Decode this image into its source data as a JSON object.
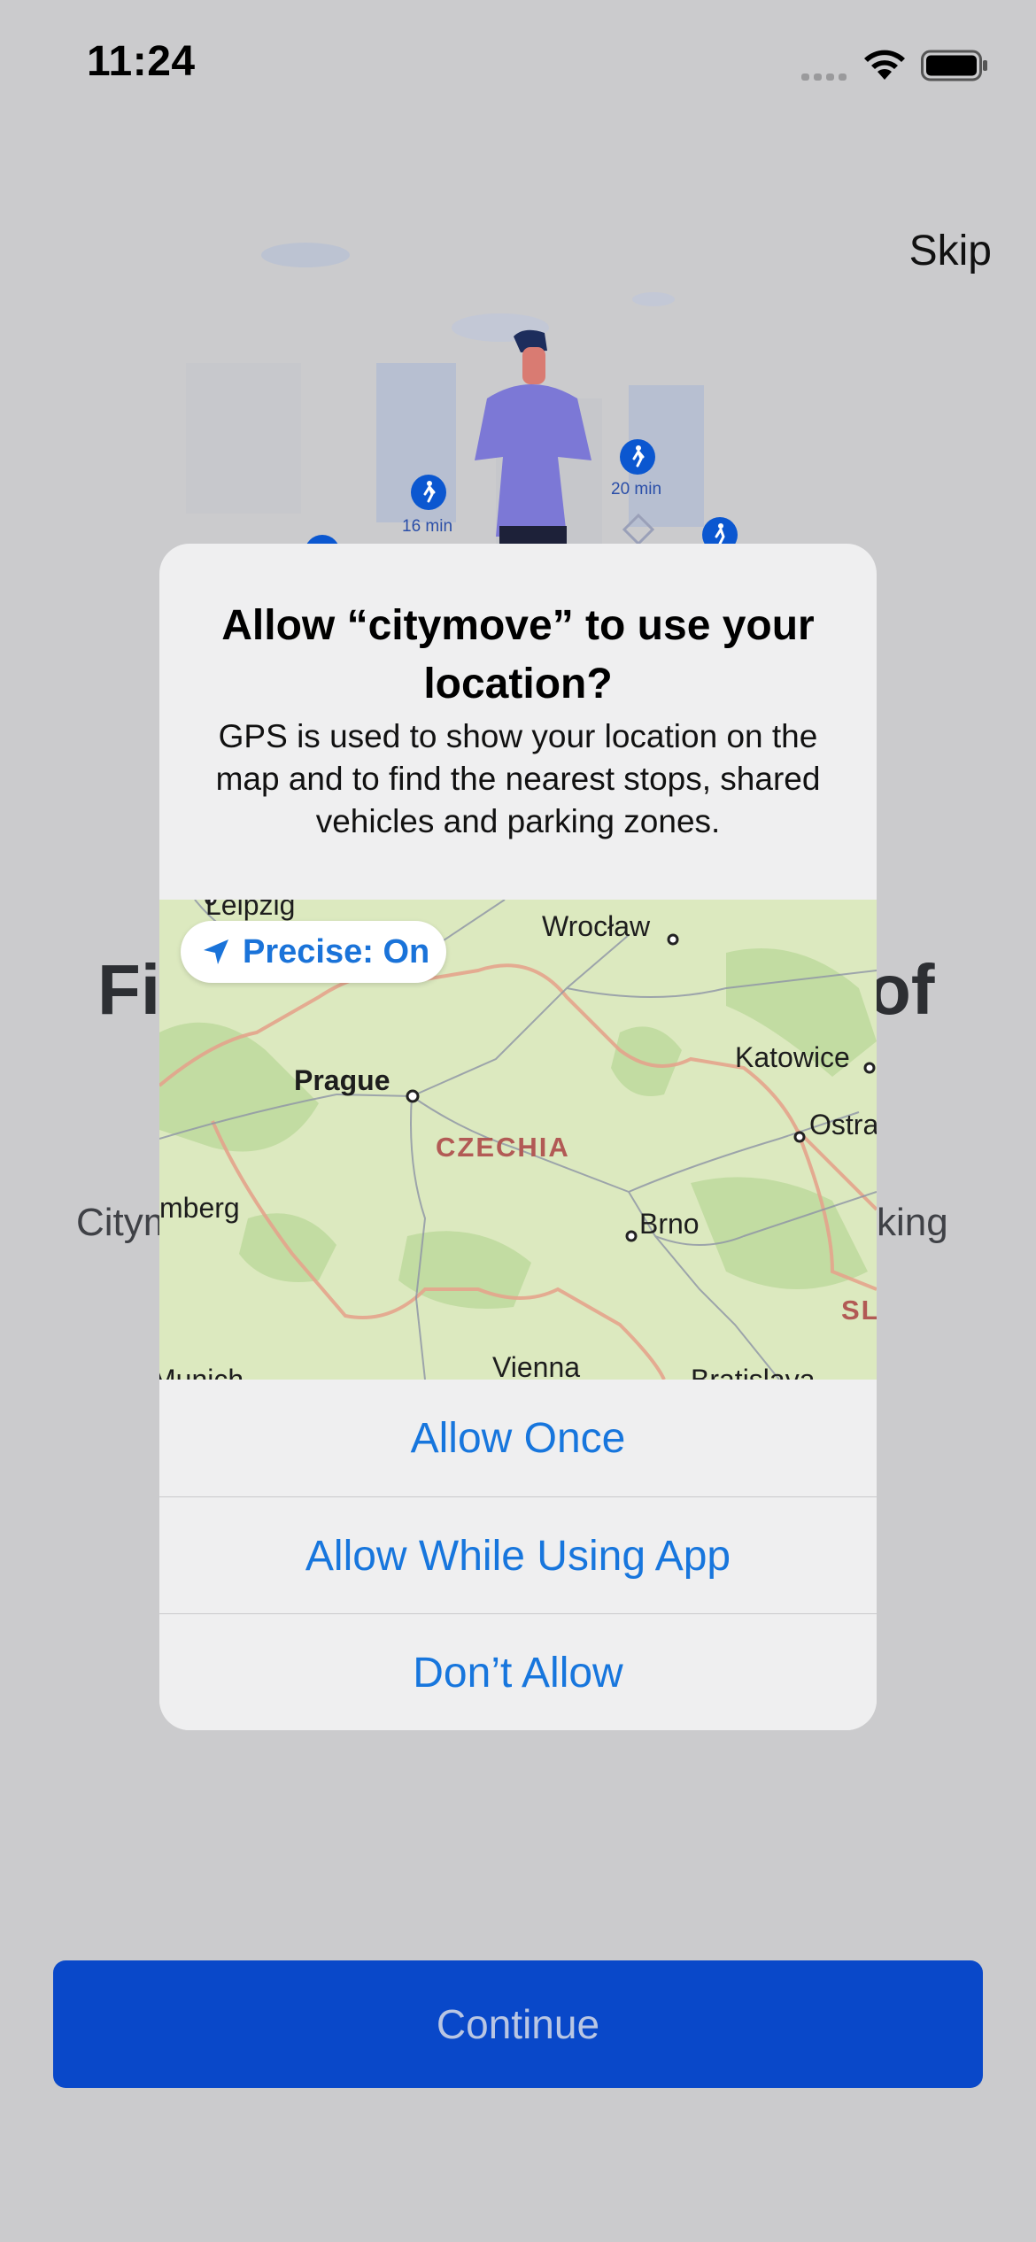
{
  "status_bar": {
    "time": "11:24"
  },
  "header": {
    "skip_label": "Skip"
  },
  "illustration": {
    "route_times": [
      "16 min",
      "20 min"
    ]
  },
  "background": {
    "title_left": "Fi",
    "title_right": "of",
    "subtitle_left": "Citym",
    "subtitle_right": "king"
  },
  "dialog": {
    "title": "Allow “citymove” to use your location?",
    "message": "GPS is used to show your location on the map and to find the nearest stops, shared vehicles and parking zones.",
    "precise_label": "Precise: On",
    "map": {
      "cities": [
        "Leipzig",
        "Wrocław",
        "Prague",
        "Katowice",
        "Ostra",
        "mberg",
        "Brno",
        "Vienna",
        "Munich",
        "Bratislava"
      ],
      "countries": [
        "CZECHIA",
        "SL"
      ]
    },
    "actions": [
      "Allow Once",
      "Allow While Using App",
      "Don’t Allow"
    ]
  },
  "footer": {
    "continue_label": "Continue"
  },
  "colors": {
    "accent": "#1776dd",
    "primary_button": "#0948c9",
    "dim_background": "#cbcbcd"
  }
}
